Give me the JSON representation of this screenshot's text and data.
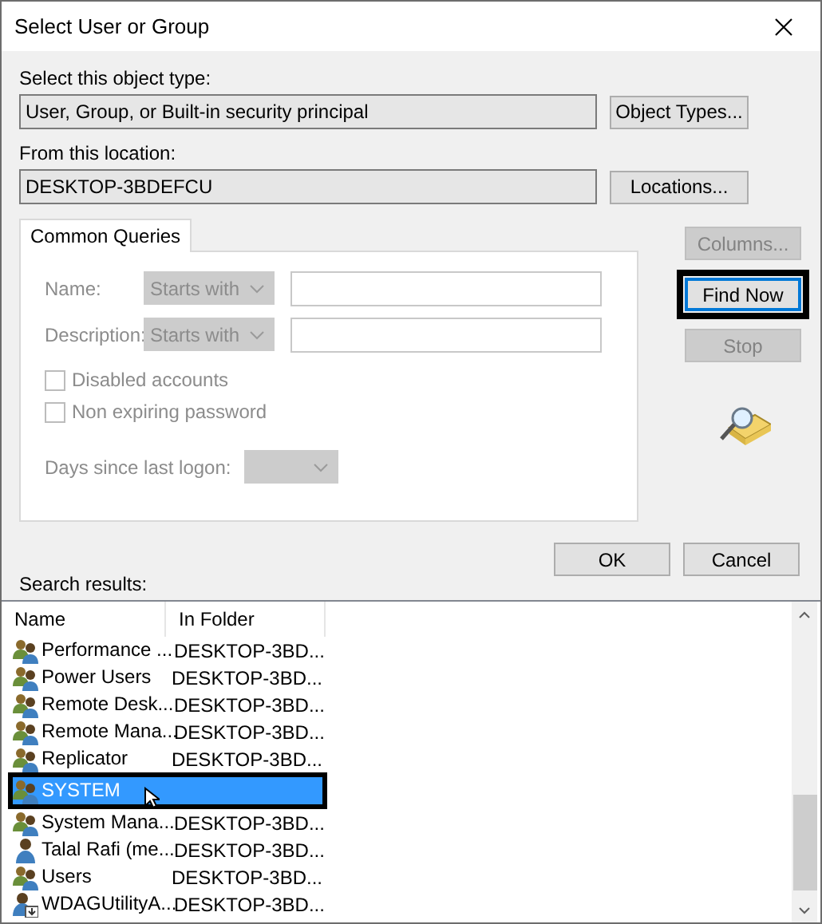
{
  "window": {
    "title": "Select User or Group"
  },
  "object_type": {
    "label": "Select this object type:",
    "value": "User, Group, or Built-in security principal",
    "button": "Object Types..."
  },
  "location": {
    "label": "From this location:",
    "value": "DESKTOP-3BDEFCU",
    "button": "Locations..."
  },
  "tabs": [
    {
      "label": "Common Queries",
      "selected": true
    }
  ],
  "query": {
    "disabled": true,
    "fields": [
      {
        "label": "Name:",
        "match": "Starts with"
      },
      {
        "label": "Description:",
        "match": "Starts with"
      }
    ],
    "checkboxes": [
      {
        "label": "Disabled accounts",
        "checked": false
      },
      {
        "label": "Non expiring password",
        "checked": false
      }
    ],
    "days_label": "Days since last logon:"
  },
  "side_buttons": [
    {
      "label": "Columns...",
      "disabled": true,
      "highlighted": false
    },
    {
      "label": "Find Now",
      "disabled": false,
      "highlighted": true
    },
    {
      "label": "Stop",
      "disabled": true,
      "highlighted": false
    }
  ],
  "dialog_buttons": [
    "OK",
    "Cancel"
  ],
  "results": {
    "label": "Search results:",
    "columns": [
      "Name",
      "In Folder"
    ],
    "rows": [
      {
        "kind": "group",
        "name": "Performance ...",
        "folder": "DESKTOP-3BD...",
        "selected": false,
        "highlighted": false
      },
      {
        "kind": "group",
        "name": "Power Users",
        "folder": "DESKTOP-3BD...",
        "selected": false,
        "highlighted": false
      },
      {
        "kind": "group",
        "name": "Remote Desk...",
        "folder": "DESKTOP-3BD...",
        "selected": false,
        "highlighted": false
      },
      {
        "kind": "group",
        "name": "Remote Mana...",
        "folder": "DESKTOP-3BD...",
        "selected": false,
        "highlighted": false
      },
      {
        "kind": "group",
        "name": "Replicator",
        "folder": "DESKTOP-3BD...",
        "selected": false,
        "highlighted": false
      },
      {
        "kind": "group",
        "name": "SYSTEM",
        "folder": "",
        "selected": true,
        "highlighted": true
      },
      {
        "kind": "group",
        "name": "System Mana...",
        "folder": "DESKTOP-3BD...",
        "selected": false,
        "highlighted": false
      },
      {
        "kind": "user",
        "name": "Talal Rafi (me...",
        "folder": "DESKTOP-3BD...",
        "selected": false,
        "highlighted": false
      },
      {
        "kind": "group",
        "name": "Users",
        "folder": "DESKTOP-3BD...",
        "selected": false,
        "highlighted": false
      },
      {
        "kind": "service",
        "name": "WDAGUtilityA...",
        "folder": "DESKTOP-3BD...",
        "selected": false,
        "highlighted": false
      }
    ]
  }
}
